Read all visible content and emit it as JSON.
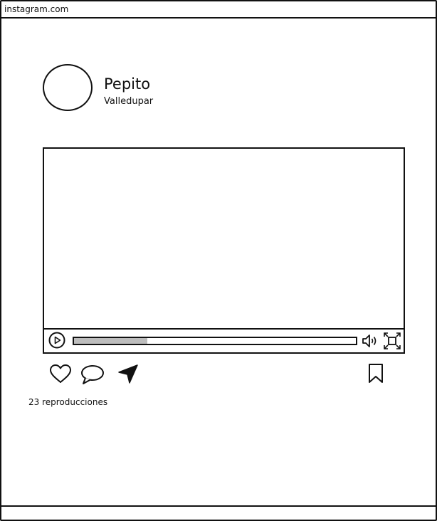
{
  "browser": {
    "url": "instagram.com"
  },
  "post": {
    "username": "Pepito",
    "location": "Valledupar",
    "views_text": "23 reproducciones"
  },
  "video_player": {
    "progress_fraction": 0.26
  },
  "icons": {
    "play": "play-icon",
    "volume": "volume-icon",
    "fullscreen": "fullscreen-icon",
    "like": "heart-icon",
    "comment": "comment-icon",
    "share": "send-icon",
    "save": "bookmark-icon"
  }
}
